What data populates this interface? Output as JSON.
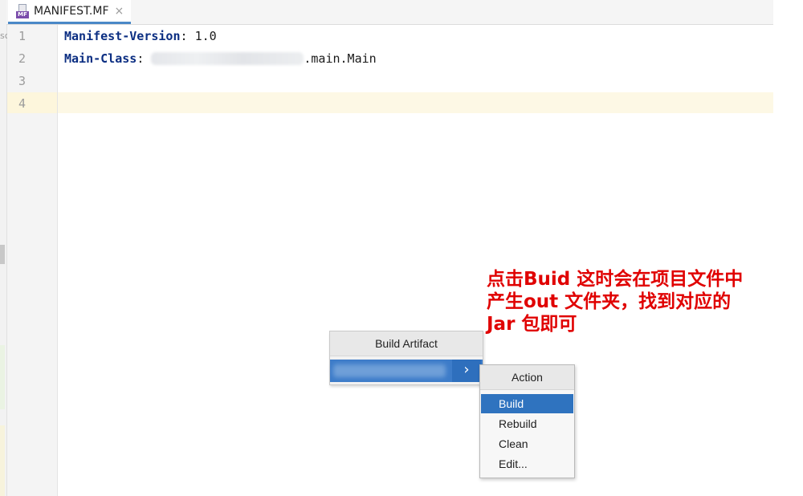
{
  "tab": {
    "icon_badge": "MF",
    "title": "MANIFEST.MF",
    "close_glyph": "×"
  },
  "side_cut_text": "sc",
  "editor": {
    "line_numbers": [
      "1",
      "2",
      "3",
      "4"
    ],
    "lines": [
      {
        "key": "Manifest-Version",
        "sep": ": ",
        "value": "1.0"
      },
      {
        "key": "Main-Class",
        "sep": ": ",
        "value_suffix": ".main.Main"
      }
    ]
  },
  "annotation": "点击Buid 这时会在项目文件中产生out 文件夹，找到对应的Jar 包即可",
  "menu_artifact": {
    "header": "Build Artifact",
    "arrow": "›"
  },
  "menu_action": {
    "header": "Action",
    "items": [
      "Build",
      "Rebuild",
      "Clean",
      "Edit..."
    ],
    "selected": "Build"
  },
  "colors": {
    "selection": "#2f73bf",
    "annotation": "#e00000",
    "key": "#0b2e82"
  }
}
